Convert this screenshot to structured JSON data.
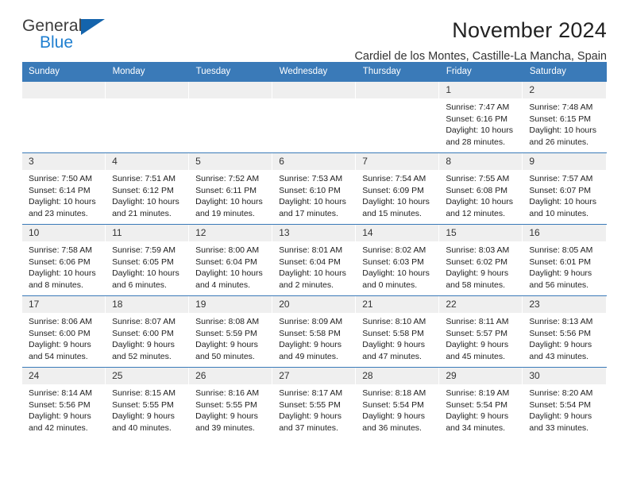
{
  "brand": {
    "name_top": "General",
    "name_bottom": "Blue",
    "accent_color": "#1f7fd0",
    "triangle_color": "#1464ac"
  },
  "header": {
    "title": "November 2024",
    "subtitle": "Cardiel de los Montes, Castille-La Mancha, Spain"
  },
  "theme": {
    "header_blue": "#3a7ab8",
    "daynum_gray": "#efefef",
    "text": "#222222"
  },
  "calendar": {
    "weekday_headers": [
      "Sunday",
      "Monday",
      "Tuesday",
      "Wednesday",
      "Thursday",
      "Friday",
      "Saturday"
    ],
    "weeks": [
      [
        {
          "day": "",
          "empty": true
        },
        {
          "day": "",
          "empty": true
        },
        {
          "day": "",
          "empty": true
        },
        {
          "day": "",
          "empty": true
        },
        {
          "day": "",
          "empty": true
        },
        {
          "day": "1",
          "sunrise": "Sunrise: 7:47 AM",
          "sunset": "Sunset: 6:16 PM",
          "daylight": "Daylight: 10 hours and 28 minutes."
        },
        {
          "day": "2",
          "sunrise": "Sunrise: 7:48 AM",
          "sunset": "Sunset: 6:15 PM",
          "daylight": "Daylight: 10 hours and 26 minutes."
        }
      ],
      [
        {
          "day": "3",
          "sunrise": "Sunrise: 7:50 AM",
          "sunset": "Sunset: 6:14 PM",
          "daylight": "Daylight: 10 hours and 23 minutes."
        },
        {
          "day": "4",
          "sunrise": "Sunrise: 7:51 AM",
          "sunset": "Sunset: 6:12 PM",
          "daylight": "Daylight: 10 hours and 21 minutes."
        },
        {
          "day": "5",
          "sunrise": "Sunrise: 7:52 AM",
          "sunset": "Sunset: 6:11 PM",
          "daylight": "Daylight: 10 hours and 19 minutes."
        },
        {
          "day": "6",
          "sunrise": "Sunrise: 7:53 AM",
          "sunset": "Sunset: 6:10 PM",
          "daylight": "Daylight: 10 hours and 17 minutes."
        },
        {
          "day": "7",
          "sunrise": "Sunrise: 7:54 AM",
          "sunset": "Sunset: 6:09 PM",
          "daylight": "Daylight: 10 hours and 15 minutes."
        },
        {
          "day": "8",
          "sunrise": "Sunrise: 7:55 AM",
          "sunset": "Sunset: 6:08 PM",
          "daylight": "Daylight: 10 hours and 12 minutes."
        },
        {
          "day": "9",
          "sunrise": "Sunrise: 7:57 AM",
          "sunset": "Sunset: 6:07 PM",
          "daylight": "Daylight: 10 hours and 10 minutes."
        }
      ],
      [
        {
          "day": "10",
          "sunrise": "Sunrise: 7:58 AM",
          "sunset": "Sunset: 6:06 PM",
          "daylight": "Daylight: 10 hours and 8 minutes."
        },
        {
          "day": "11",
          "sunrise": "Sunrise: 7:59 AM",
          "sunset": "Sunset: 6:05 PM",
          "daylight": "Daylight: 10 hours and 6 minutes."
        },
        {
          "day": "12",
          "sunrise": "Sunrise: 8:00 AM",
          "sunset": "Sunset: 6:04 PM",
          "daylight": "Daylight: 10 hours and 4 minutes."
        },
        {
          "day": "13",
          "sunrise": "Sunrise: 8:01 AM",
          "sunset": "Sunset: 6:04 PM",
          "daylight": "Daylight: 10 hours and 2 minutes."
        },
        {
          "day": "14",
          "sunrise": "Sunrise: 8:02 AM",
          "sunset": "Sunset: 6:03 PM",
          "daylight": "Daylight: 10 hours and 0 minutes."
        },
        {
          "day": "15",
          "sunrise": "Sunrise: 8:03 AM",
          "sunset": "Sunset: 6:02 PM",
          "daylight": "Daylight: 9 hours and 58 minutes."
        },
        {
          "day": "16",
          "sunrise": "Sunrise: 8:05 AM",
          "sunset": "Sunset: 6:01 PM",
          "daylight": "Daylight: 9 hours and 56 minutes."
        }
      ],
      [
        {
          "day": "17",
          "sunrise": "Sunrise: 8:06 AM",
          "sunset": "Sunset: 6:00 PM",
          "daylight": "Daylight: 9 hours and 54 minutes."
        },
        {
          "day": "18",
          "sunrise": "Sunrise: 8:07 AM",
          "sunset": "Sunset: 6:00 PM",
          "daylight": "Daylight: 9 hours and 52 minutes."
        },
        {
          "day": "19",
          "sunrise": "Sunrise: 8:08 AM",
          "sunset": "Sunset: 5:59 PM",
          "daylight": "Daylight: 9 hours and 50 minutes."
        },
        {
          "day": "20",
          "sunrise": "Sunrise: 8:09 AM",
          "sunset": "Sunset: 5:58 PM",
          "daylight": "Daylight: 9 hours and 49 minutes."
        },
        {
          "day": "21",
          "sunrise": "Sunrise: 8:10 AM",
          "sunset": "Sunset: 5:58 PM",
          "daylight": "Daylight: 9 hours and 47 minutes."
        },
        {
          "day": "22",
          "sunrise": "Sunrise: 8:11 AM",
          "sunset": "Sunset: 5:57 PM",
          "daylight": "Daylight: 9 hours and 45 minutes."
        },
        {
          "day": "23",
          "sunrise": "Sunrise: 8:13 AM",
          "sunset": "Sunset: 5:56 PM",
          "daylight": "Daylight: 9 hours and 43 minutes."
        }
      ],
      [
        {
          "day": "24",
          "sunrise": "Sunrise: 8:14 AM",
          "sunset": "Sunset: 5:56 PM",
          "daylight": "Daylight: 9 hours and 42 minutes."
        },
        {
          "day": "25",
          "sunrise": "Sunrise: 8:15 AM",
          "sunset": "Sunset: 5:55 PM",
          "daylight": "Daylight: 9 hours and 40 minutes."
        },
        {
          "day": "26",
          "sunrise": "Sunrise: 8:16 AM",
          "sunset": "Sunset: 5:55 PM",
          "daylight": "Daylight: 9 hours and 39 minutes."
        },
        {
          "day": "27",
          "sunrise": "Sunrise: 8:17 AM",
          "sunset": "Sunset: 5:55 PM",
          "daylight": "Daylight: 9 hours and 37 minutes."
        },
        {
          "day": "28",
          "sunrise": "Sunrise: 8:18 AM",
          "sunset": "Sunset: 5:54 PM",
          "daylight": "Daylight: 9 hours and 36 minutes."
        },
        {
          "day": "29",
          "sunrise": "Sunrise: 8:19 AM",
          "sunset": "Sunset: 5:54 PM",
          "daylight": "Daylight: 9 hours and 34 minutes."
        },
        {
          "day": "30",
          "sunrise": "Sunrise: 8:20 AM",
          "sunset": "Sunset: 5:54 PM",
          "daylight": "Daylight: 9 hours and 33 minutes."
        }
      ]
    ]
  }
}
